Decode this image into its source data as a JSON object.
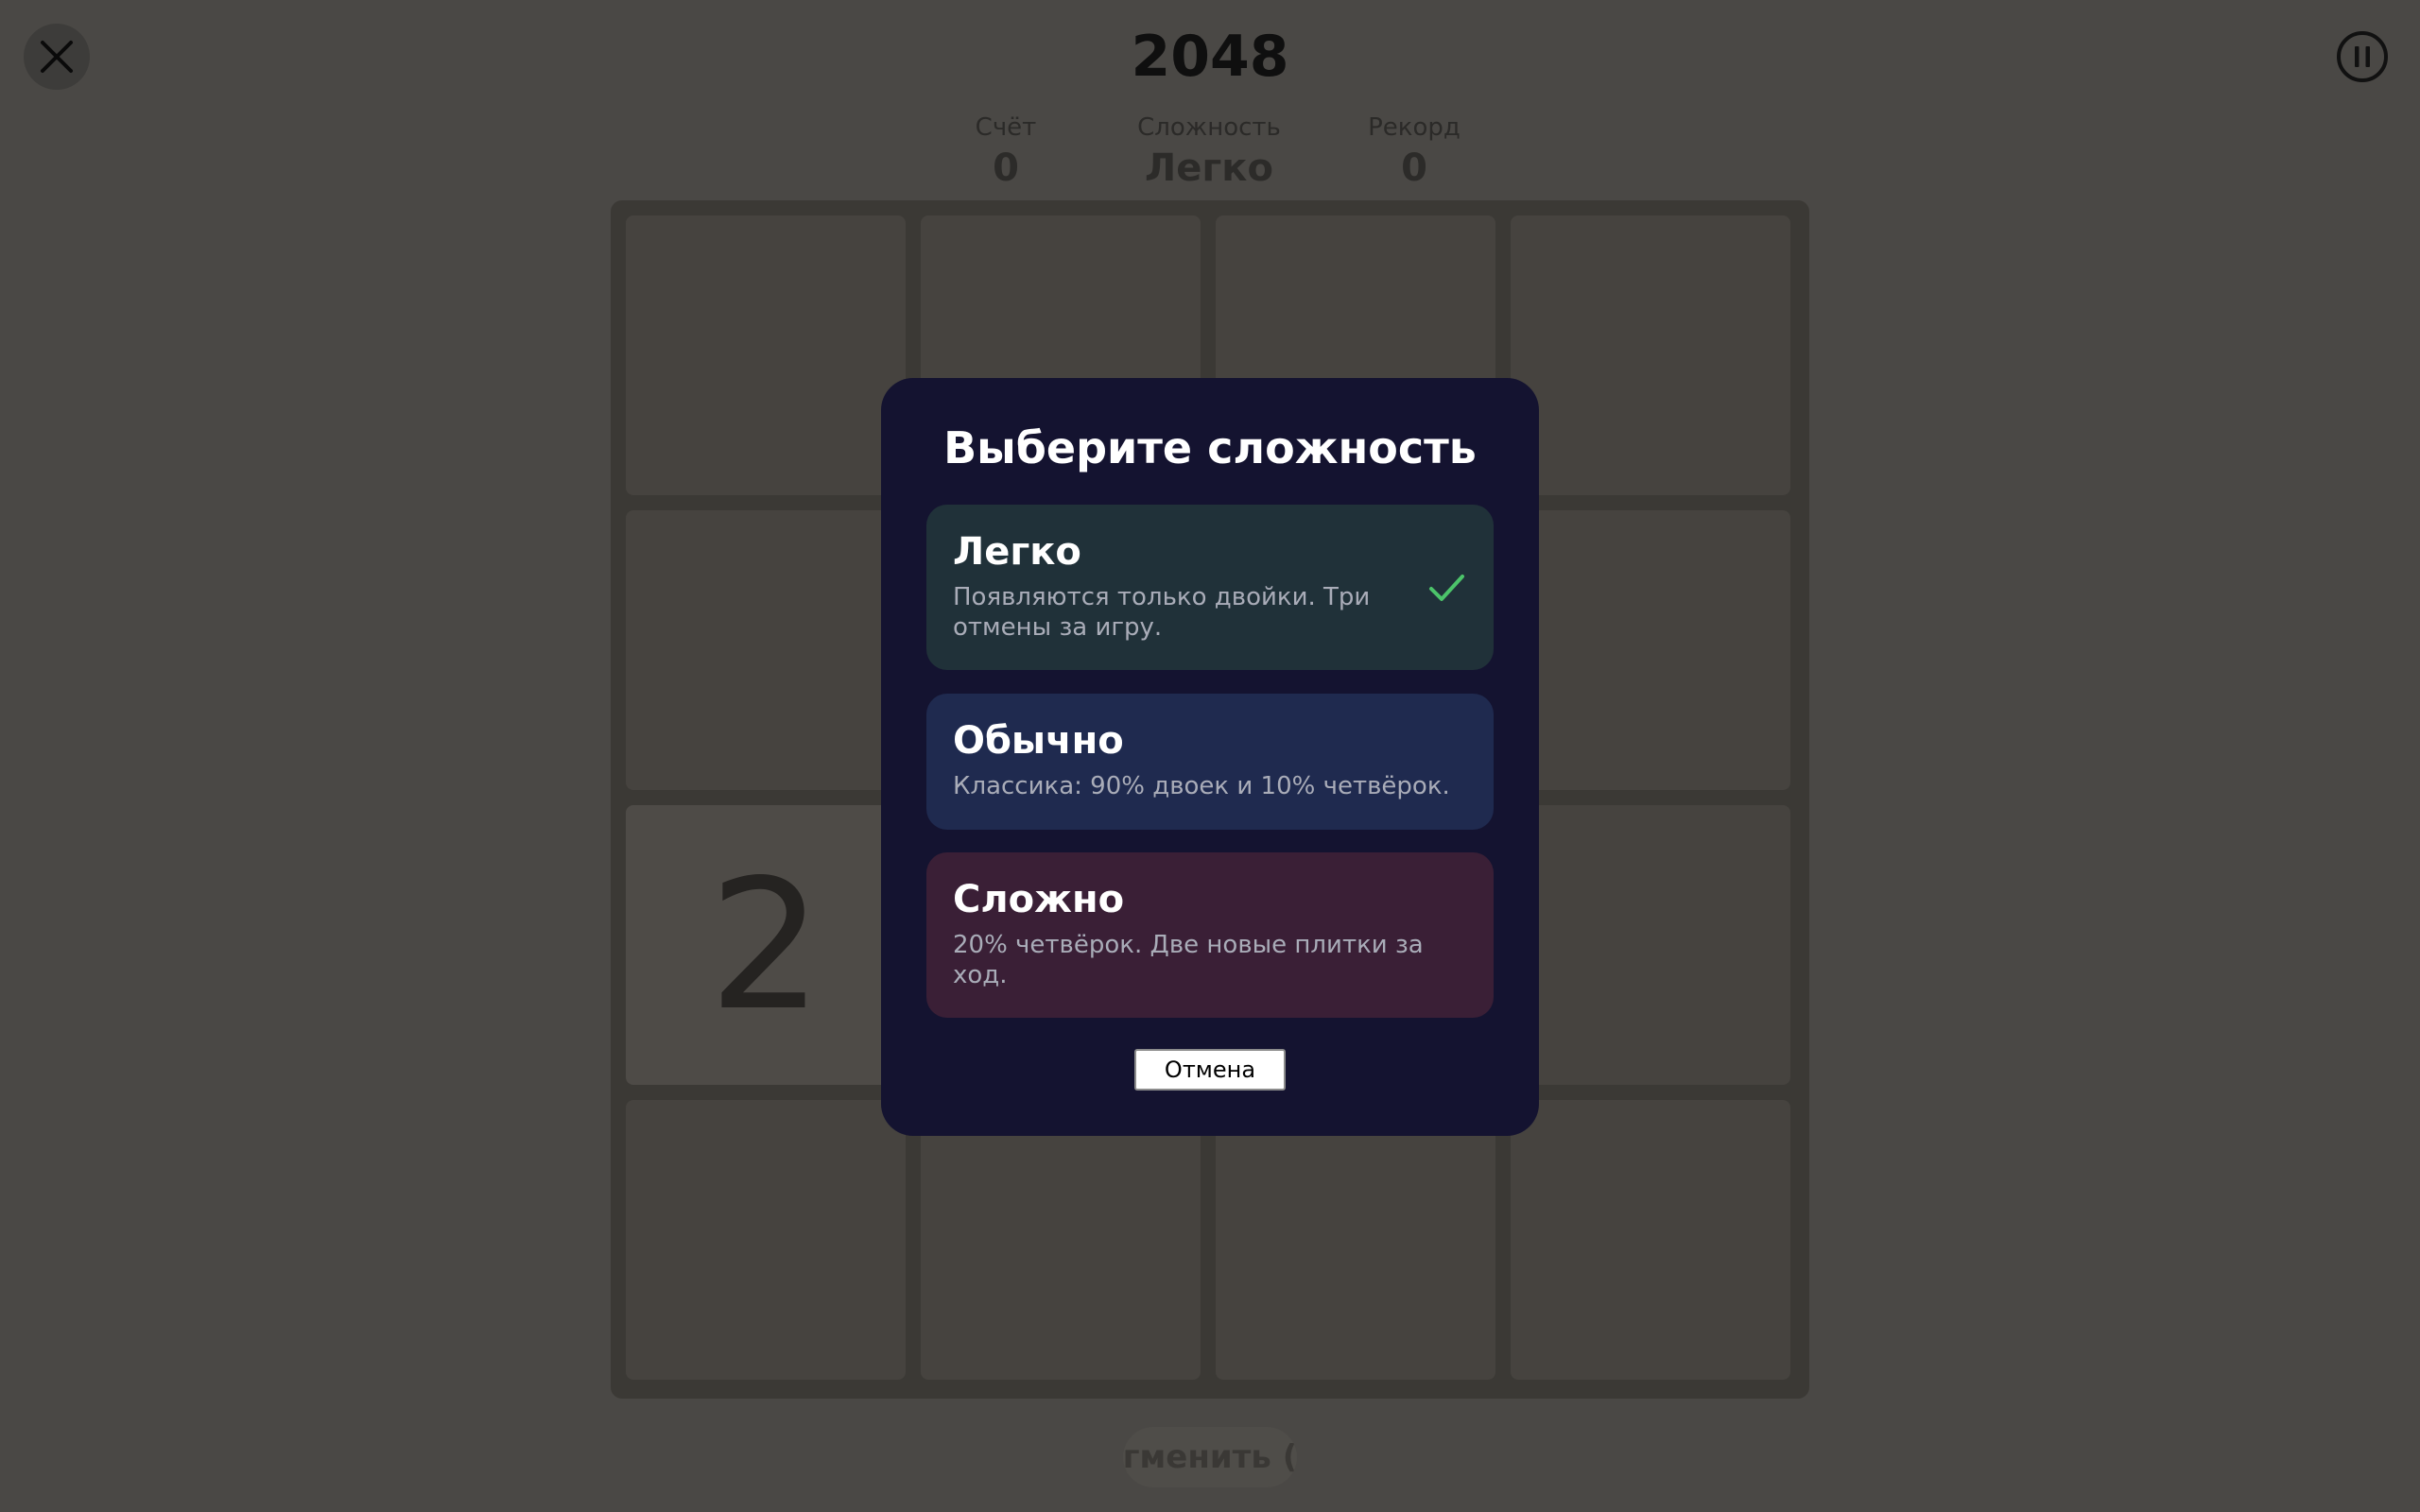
{
  "header": {
    "title": "2048",
    "close_icon": "close-icon",
    "pause_icon": "pause-icon"
  },
  "stats": {
    "score_label": "Счёт",
    "score_value": "0",
    "difficulty_label": "Сложность",
    "difficulty_value": "Легко",
    "best_label": "Рекорд",
    "best_value": "0"
  },
  "board": {
    "size": 4,
    "tiles": [
      {
        "row": 2,
        "col": 0,
        "value": "2"
      }
    ]
  },
  "undo": {
    "label": "гменить ("
  },
  "modal": {
    "title": "Выберите сложность",
    "options": [
      {
        "title": "Легко",
        "description": "Появляются только двойки. Три отмены за игру.",
        "selected": true,
        "color": "#203139"
      },
      {
        "title": "Обычно",
        "description": "Классика: 90% двоек и 10% четвёрок.",
        "selected": false,
        "color": "#1f2a4f"
      },
      {
        "title": "Сложно",
        "description": "20% четвёрок. Две новые плитки за ход.",
        "selected": false,
        "color": "#3a1f36"
      }
    ],
    "cancel_label": "Отмена",
    "check_icon": "check-icon",
    "check_color": "#4cc46a"
  }
}
